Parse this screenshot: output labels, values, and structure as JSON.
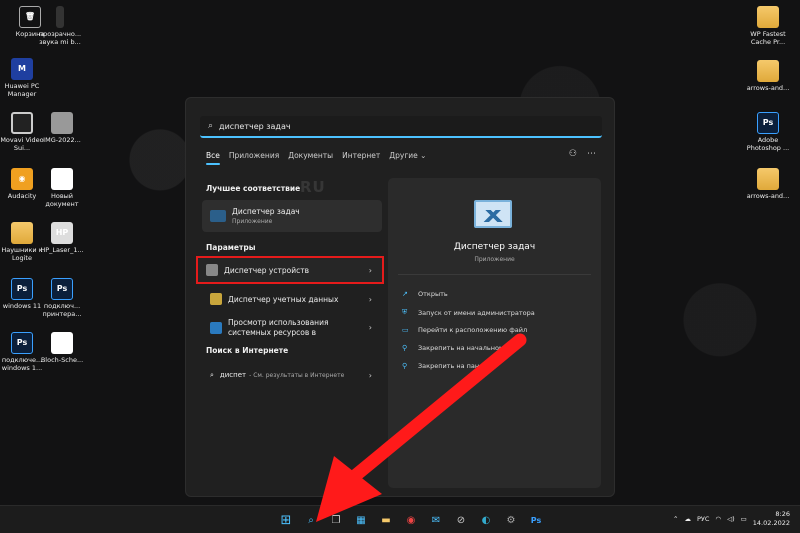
{
  "desktop_icons_left": [
    {
      "label": "Корзина",
      "icon": "recycle-bin-icon"
    },
    {
      "label": "прозрачно... звука mi b...",
      "icon": "phone-icon"
    },
    {
      "label": "Huawei PC Manager",
      "icon": "huawei-icon"
    },
    {
      "label": "Movavi Video Sui...",
      "icon": "movavi-icon"
    },
    {
      "label": "IMG-2022...",
      "icon": "image-icon"
    },
    {
      "label": "Audacity",
      "icon": "audacity-icon"
    },
    {
      "label": "Новый документ",
      "icon": "pdf-icon"
    },
    {
      "label": "Наушники к Logite",
      "icon": "folder-icon"
    },
    {
      "label": "HP_Laser_1...",
      "icon": "hp-icon"
    },
    {
      "label": "windows 11",
      "icon": "psd-icon"
    },
    {
      "label": "подключ... принтера...",
      "icon": "psd-icon"
    },
    {
      "label": "подключе... windows 1...",
      "icon": "psd-icon"
    },
    {
      "label": "Bloch-Sche...",
      "icon": "pdf-icon"
    }
  ],
  "desktop_icons_right": [
    {
      "label": "WP Fastest Cache Pr...",
      "icon": "folder-icon"
    },
    {
      "label": "arrows-and...",
      "icon": "folder-icon"
    },
    {
      "label": "Adobe Photoshop ...",
      "icon": "photoshop-icon"
    },
    {
      "label": "arrows-and...",
      "icon": "folder-icon"
    }
  ],
  "search": {
    "query": "диспетчер задач"
  },
  "tabs": [
    "Все",
    "Приложения",
    "Документы",
    "Интернет",
    "Другие ⌄"
  ],
  "best_match": {
    "heading": "Лучшее соответствие",
    "title": "Диспетчер задач",
    "subtitle": "Приложение"
  },
  "settings": {
    "heading": "Параметры",
    "items": [
      "Диспетчер устройств",
      "Диспетчер учетных данных",
      "Просмотр использования системных ресурсов в"
    ]
  },
  "web": {
    "heading": "Поиск в Интернете",
    "query": "диспет",
    "hint": "- См. результаты в Интернете"
  },
  "detail": {
    "title": "Диспетчер задач",
    "subtitle": "Приложение",
    "actions": [
      "Открыть",
      "Запуск от имени администратора",
      "Перейти к расположению файл",
      "Закрепить на начальном",
      "Закрепить на пан"
    ]
  },
  "watermark": "RU",
  "tray": {
    "lang": "РУС",
    "time": "8:26",
    "date": "14.02.2022"
  },
  "colors": {
    "accent": "#4cc2ff",
    "highlight_box": "#e51b1b",
    "arrow": "#ff1a1a"
  }
}
